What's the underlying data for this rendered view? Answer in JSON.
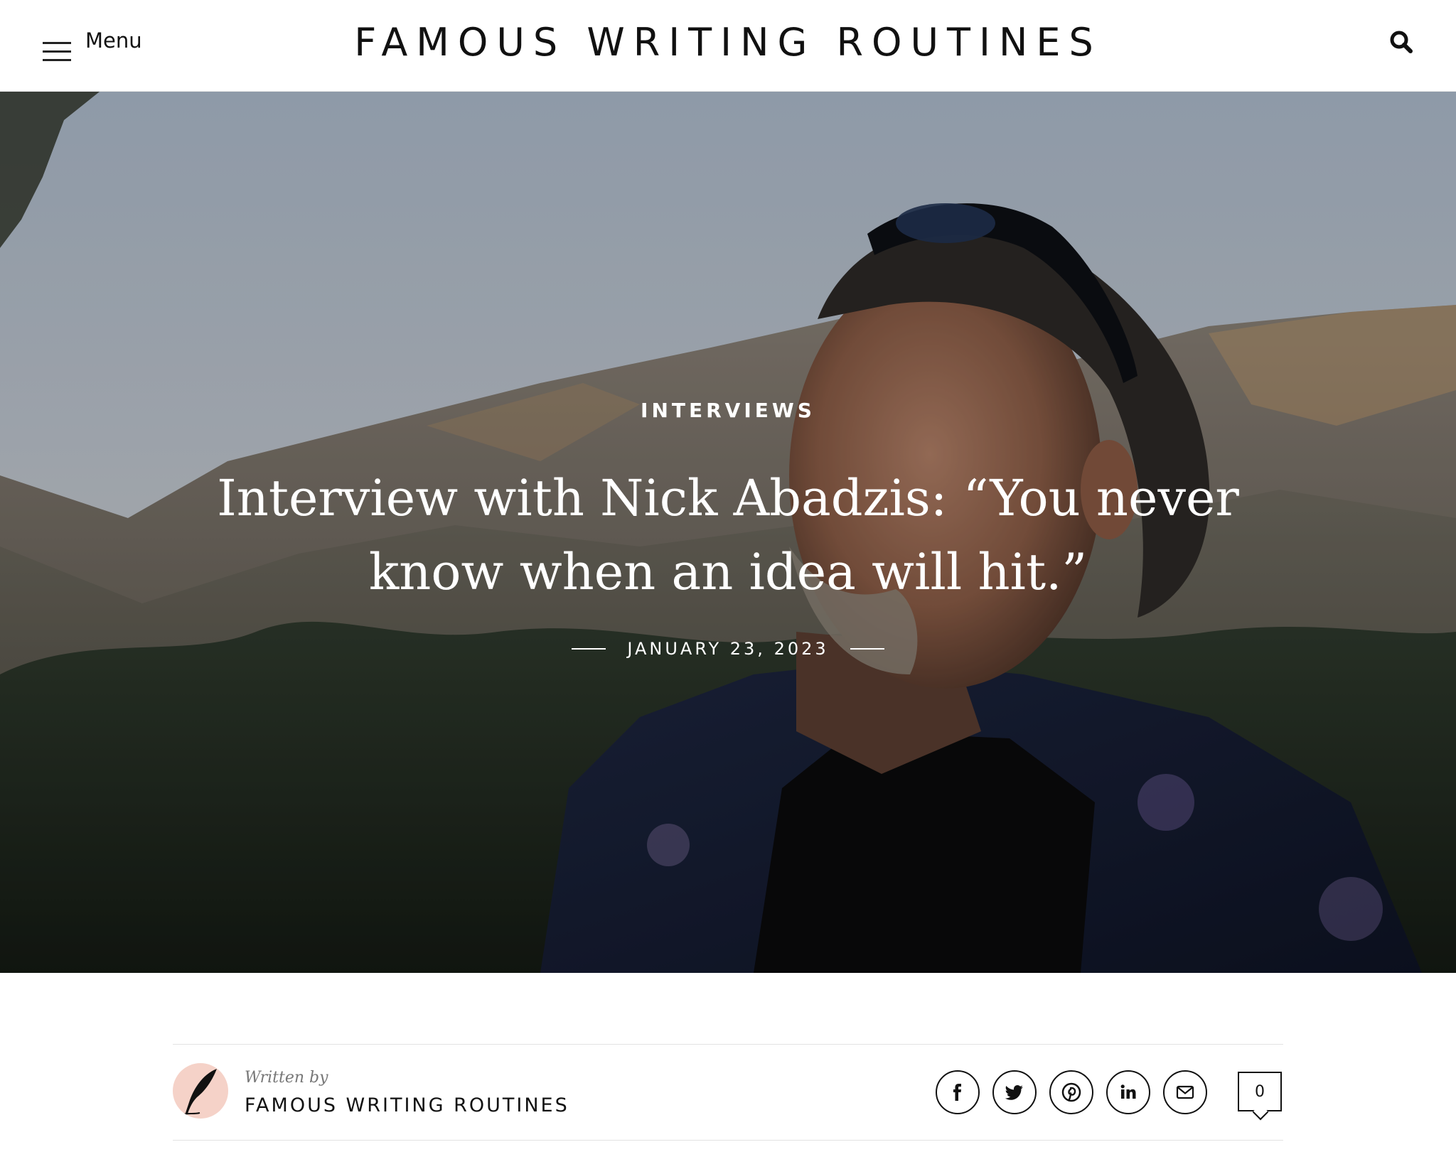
{
  "header": {
    "menu_label": "Menu",
    "site_title": "FAMOUS WRITING ROUTINES",
    "icons": {
      "menu": "hamburger-icon",
      "search": "search-icon"
    }
  },
  "hero": {
    "category": "INTERVIEWS",
    "title": "Interview with Nick Abadzis: “You never know when an idea will hit.”",
    "date": "JANUARY 23, 2023"
  },
  "author": {
    "written_by": "Written by",
    "name": "FAMOUS WRITING ROUTINES",
    "avatar_icon": "quill-feather-icon"
  },
  "share": {
    "icons": [
      "facebook-icon",
      "twitter-icon",
      "pinterest-icon",
      "linkedin-icon",
      "email-icon"
    ],
    "comment_count": "0"
  },
  "colors": {
    "text": "#111111",
    "avatar_bg": "#f5d2c8",
    "divider": "#e2e2e2"
  }
}
